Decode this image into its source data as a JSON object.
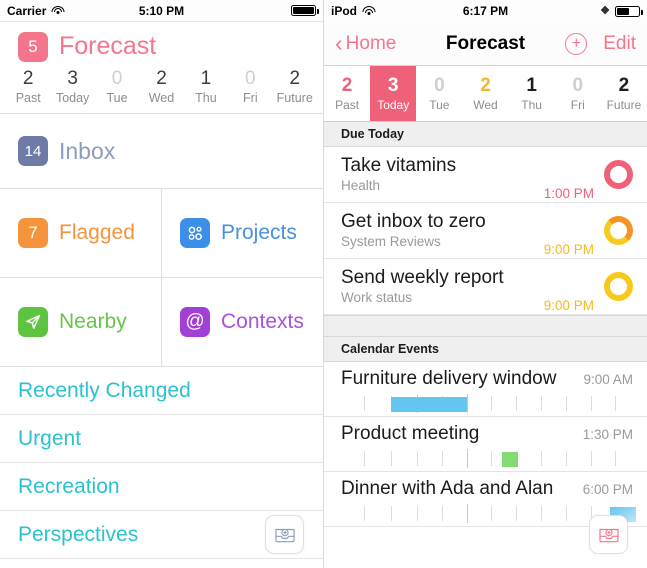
{
  "left_panel": {
    "status_bar": {
      "carrier": "Carrier",
      "wifi_icon": "wifi-icon",
      "time": "5:10 PM",
      "battery_icon": "battery-full-icon",
      "battery_level": 100
    },
    "header": {
      "badge_count": "5",
      "badge_color": "#f4768c",
      "title": "Forecast",
      "title_color": "#f4768c"
    },
    "daybar": [
      {
        "count": "2",
        "label": "Past",
        "dim": false
      },
      {
        "count": "3",
        "label": "Today",
        "dim": false
      },
      {
        "count": "0",
        "label": "Tue",
        "dim": true
      },
      {
        "count": "2",
        "label": "Wed",
        "dim": false
      },
      {
        "count": "1",
        "label": "Thu",
        "dim": false
      },
      {
        "count": "0",
        "label": "Fri",
        "dim": true
      },
      {
        "count": "2",
        "label": "Future",
        "dim": false
      }
    ],
    "inbox": {
      "badge_count": "14",
      "badge_color": "#6e7ba6",
      "label": "Inbox",
      "label_color": "#8e9bbd"
    },
    "grid": [
      {
        "icon": "flag-badge-icon",
        "badge_count": "7",
        "color": "#f5943c",
        "label": "Flagged",
        "label_color": "#f5943c"
      },
      {
        "icon": "projects-dots-icon",
        "badge_count": "",
        "color": "#3b8fe8",
        "label": "Projects",
        "label_color": "#4a90d9"
      },
      {
        "icon": "location-arrow-icon",
        "badge_count": "",
        "color": "#5fc342",
        "label": "Nearby",
        "label_color": "#68c44c"
      },
      {
        "icon": "at-sign-icon",
        "badge_count": "",
        "color": "#a240d6",
        "label": "Contexts",
        "label_color": "#a852d9"
      }
    ],
    "perspectives": [
      {
        "label": "Recently Changed"
      },
      {
        "label": "Urgent"
      },
      {
        "label": "Recreation"
      },
      {
        "label": "Perspectives"
      }
    ],
    "perspective_color": "#2bc2cf",
    "fab": {
      "icon": "inbox-add-icon",
      "color": "#8e9bbd"
    }
  },
  "right_panel": {
    "status_bar": {
      "device": "iPod",
      "wifi_icon": "wifi-icon",
      "time": "6:17 PM",
      "bluetooth_icon": "bluetooth-icon",
      "battery_icon": "battery-half-icon",
      "battery_level": 55
    },
    "navbar": {
      "back_icon": "chevron-left-icon",
      "back_label": "Home",
      "title": "Forecast",
      "add_icon": "plus-circle-icon",
      "edit_label": "Edit",
      "accent_color": "#f4768c"
    },
    "daybar": [
      {
        "count": "2",
        "label": "Past",
        "color": "#ef6179",
        "selected": false
      },
      {
        "count": "3",
        "label": "Today",
        "color": "#ffffff",
        "selected": true
      },
      {
        "count": "0",
        "label": "Tue",
        "color": "#cfcfcf",
        "selected": false
      },
      {
        "count": "2",
        "label": "Wed",
        "color": "#f5b820",
        "selected": false
      },
      {
        "count": "1",
        "label": "Thu",
        "color": "#1c1c1c",
        "selected": false
      },
      {
        "count": "0",
        "label": "Fri",
        "color": "#cfcfcf",
        "selected": false
      },
      {
        "count": "2",
        "label": "Future",
        "color": "#1c1c1c",
        "selected": false
      }
    ],
    "due_today": {
      "header": "Due Today",
      "tasks": [
        {
          "title": "Take vitamins",
          "project": "Health",
          "time": "1:00 PM",
          "time_color": "#ef6179",
          "ring_color": "#ef6179",
          "ring_color2": "#ef6179"
        },
        {
          "title": "Get inbox to zero",
          "project": "System Reviews",
          "time": "9:00 PM",
          "time_color": "#f5b820",
          "ring_color": "#f39423",
          "ring_color2": "#f7cc1e"
        },
        {
          "title": "Send weekly report",
          "project": "Work status",
          "time": "9:00 PM",
          "time_color": "#f5b820",
          "ring_color": "#f7c91c",
          "ring_color2": "#f7c91c"
        }
      ]
    },
    "calendar": {
      "header": "Calendar Events",
      "events": [
        {
          "title": "Furniture delivery window",
          "time": "9:00 AM",
          "block_color": "#63c6f0",
          "block_start_pct": 17,
          "block_width_pct": 26,
          "ticks": 11
        },
        {
          "title": "Product meeting",
          "time": "1:30 PM",
          "block_color": "#84db76",
          "block_start_pct": 55,
          "block_width_pct": 5,
          "ticks": 11
        },
        {
          "title": "Dinner with Ada and Alan",
          "time": "6:00 PM",
          "block_color": "#63c6f0",
          "block_start_pct": 93,
          "block_width_pct": 9,
          "ticks": 11
        }
      ]
    },
    "fab": {
      "icon": "inbox-add-icon",
      "color": "#f4768c"
    }
  }
}
